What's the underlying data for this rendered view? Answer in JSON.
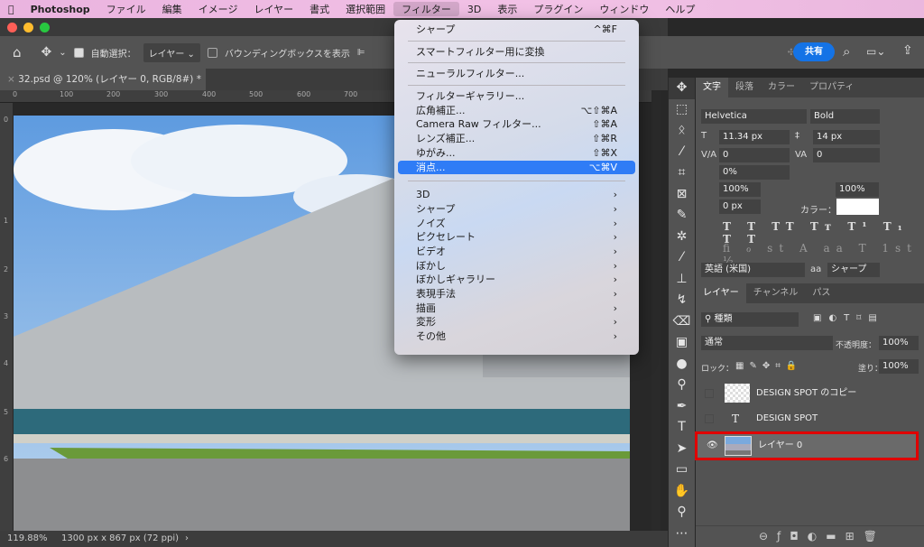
{
  "menubar": {
    "apple": "",
    "app": "Photoshop",
    "items": [
      "ファイル",
      "編集",
      "イメージ",
      "レイヤー",
      "書式",
      "選択範囲",
      "フィルター",
      "3D",
      "表示",
      "プラグイン",
      "ウィンドウ",
      "ヘルプ"
    ]
  },
  "options": {
    "auto_select_label": "自動選択：",
    "auto_select_value": "レイヤー",
    "auto_select_checked": true,
    "bbox_label": "バウンディングボックスを表示",
    "bbox_checked": false,
    "share": "共有"
  },
  "document": {
    "tab": "32.psd @ 120% (レイヤー 0, RGB/8#) *",
    "ruler_h": [
      "0",
      "100",
      "200",
      "300",
      "400",
      "500",
      "600",
      "700"
    ],
    "ruler_v": [
      "0",
      "1",
      "2",
      "3",
      "4",
      "5",
      "6"
    ]
  },
  "status": {
    "zoom": "119.88%",
    "size": "1300 px x 867 px (72 ppi)"
  },
  "filter_menu": {
    "group1": [
      {
        "label": "シャープ",
        "shortcut": "^⌘F"
      }
    ],
    "group2": [
      {
        "label": "スマートフィルター用に変換",
        "shortcut": ""
      }
    ],
    "group3": [
      {
        "label": "ニューラルフィルター...",
        "shortcut": ""
      }
    ],
    "group4": [
      {
        "label": "フィルターギャラリー...",
        "shortcut": ""
      },
      {
        "label": "広角補正...",
        "shortcut": "⌥⇧⌘A"
      },
      {
        "label": "Camera Raw フィルター...",
        "shortcut": "⇧⌘A"
      },
      {
        "label": "レンズ補正...",
        "shortcut": "⇧⌘R"
      },
      {
        "label": "ゆがみ...",
        "shortcut": "⇧⌘X"
      },
      {
        "label": "消点...",
        "shortcut": "⌥⌘V",
        "highlighted": true
      }
    ],
    "submenus": [
      "3D",
      "シャープ",
      "ノイズ",
      "ピクセレート",
      "ビデオ",
      "ぼかし",
      "ぼかしギャラリー",
      "表現手法",
      "描画",
      "変形",
      "その他"
    ]
  },
  "character_panel": {
    "tabs": [
      "文字",
      "段落",
      "カラー",
      "プロパティ"
    ],
    "font": "Helvetica",
    "style": "Bold",
    "size": "11.34 px",
    "leading": "14 px",
    "kerning": "0",
    "tracking": "0",
    "tsume": "0%",
    "vscale": "100%",
    "hscale": "100%",
    "baseline": "0 px",
    "color_label": "カラー：",
    "color": "#ffffff",
    "language": "英語 (米国)",
    "aa_label": "aa",
    "antialias": "シャープ"
  },
  "layers_panel": {
    "tabs": [
      "レイヤー",
      "チャンネル",
      "パス"
    ],
    "filter": "種類",
    "blend": "通常",
    "opacity_label": "不透明度：",
    "opacity": "100%",
    "lock_label": "ロック：",
    "fill_label": "塗り：",
    "fill": "100%",
    "layers": [
      {
        "name": "DESIGN SPOT のコピー",
        "visible": false
      },
      {
        "name": "DESIGN SPOT",
        "visible": false,
        "type": "text"
      },
      {
        "name": "レイヤー 0",
        "visible": true,
        "selected": true
      }
    ]
  },
  "colors": {
    "accent": "#1473e6",
    "highlight": "#2f7cf6",
    "selection_box": "#e00000"
  }
}
